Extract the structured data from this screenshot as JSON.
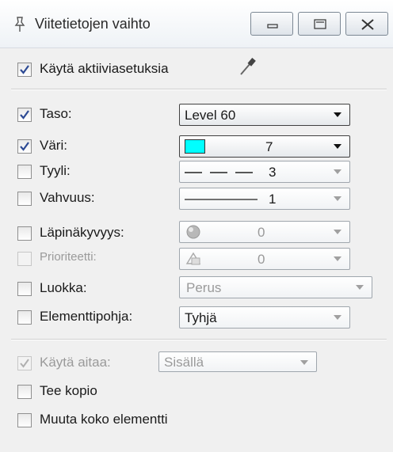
{
  "window": {
    "title": "Viitetietojen vaihto",
    "icon": "pin-icon"
  },
  "use_active": {
    "label": "Käytä aktiiviasetuksia",
    "checked": true,
    "icon": "eyedropper-icon"
  },
  "rows": [
    {
      "label": "Taso:",
      "checked": true,
      "value": "Level 60"
    },
    {
      "label": "Väri:",
      "checked": true,
      "value": "7",
      "swatch_color": "#00ffff"
    },
    {
      "label": "Tyyli:",
      "checked": false,
      "value": "3"
    },
    {
      "label": "Vahvuus:",
      "checked": false,
      "value": "1"
    },
    {
      "label": "Läpinäkyvyys:",
      "checked": false,
      "value": "0"
    },
    {
      "label": "Prioriteetti:",
      "checked": false,
      "value": "0",
      "disabled": true
    },
    {
      "label": "Luokka:",
      "checked": false,
      "value": "Perus"
    },
    {
      "label": "Elementtipohja:",
      "checked": false,
      "value": "Tyhjä"
    }
  ],
  "fence": {
    "label": "Käytä aitaa:",
    "checked": true,
    "disabled": true,
    "value": "Sisällä"
  },
  "copy": {
    "label": "Tee kopio",
    "checked": false
  },
  "resize": {
    "label": "Muuta koko elementti",
    "checked": false
  },
  "colors": {
    "check_mark": "#2d4a94",
    "swatch": "#00ffff"
  }
}
